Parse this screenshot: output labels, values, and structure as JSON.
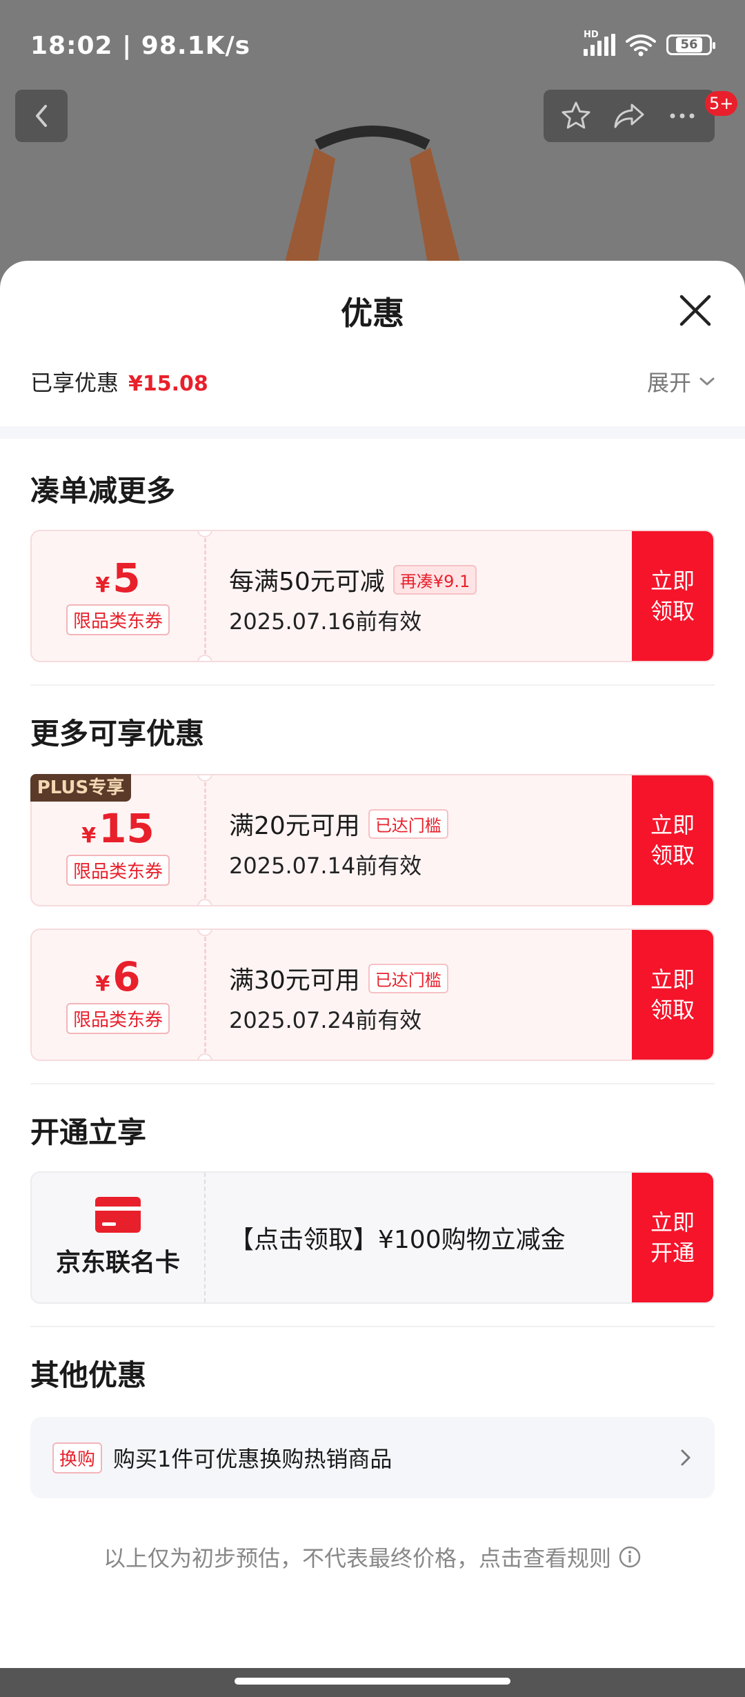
{
  "status": {
    "time": "18:02 | 98.1K/s",
    "hd": "HD",
    "battery": "56"
  },
  "nav": {
    "badge": "5+"
  },
  "sheet": {
    "title": "优惠",
    "enjoyed_label": "已享优惠",
    "enjoyed_amount": "¥15.08",
    "expand_label": "展开"
  },
  "sections": {
    "more_for_order": "凑单减更多",
    "more_discounts": "更多可享优惠",
    "open_enjoy": "开通立享",
    "other": "其他优惠"
  },
  "coupons": [
    {
      "symbol": "¥",
      "amount": "5",
      "type": "限品类东券",
      "condition": "每满50元可减",
      "badge": "再凑¥9.1",
      "expiry": "2025.07.16前有效",
      "button": "立即\n领取"
    },
    {
      "plus_tag": "PLUS专享",
      "symbol": "¥",
      "amount": "15",
      "type": "限品类东券",
      "condition": "满20元可用",
      "badge": "已达门槛",
      "expiry": "2025.07.14前有效",
      "button": "立即\n领取"
    },
    {
      "symbol": "¥",
      "amount": "6",
      "type": "限品类东券",
      "condition": "满30元可用",
      "badge": "已达门槛",
      "expiry": "2025.07.24前有效",
      "button": "立即\n领取"
    }
  ],
  "card_offer": {
    "name": "京东联名卡",
    "text": "【点击领取】¥100购物立减金",
    "button": "立即\n开通"
  },
  "other_offer": {
    "badge": "换购",
    "text": "购买1件可优惠换购热销商品"
  },
  "disclaimer": "以上仅为初步预估，不代表最终价格，点击查看规则",
  "colors": {
    "accent": "#f5142a",
    "price_red": "#e8202b",
    "plus_bg": "#5b3a2a"
  }
}
